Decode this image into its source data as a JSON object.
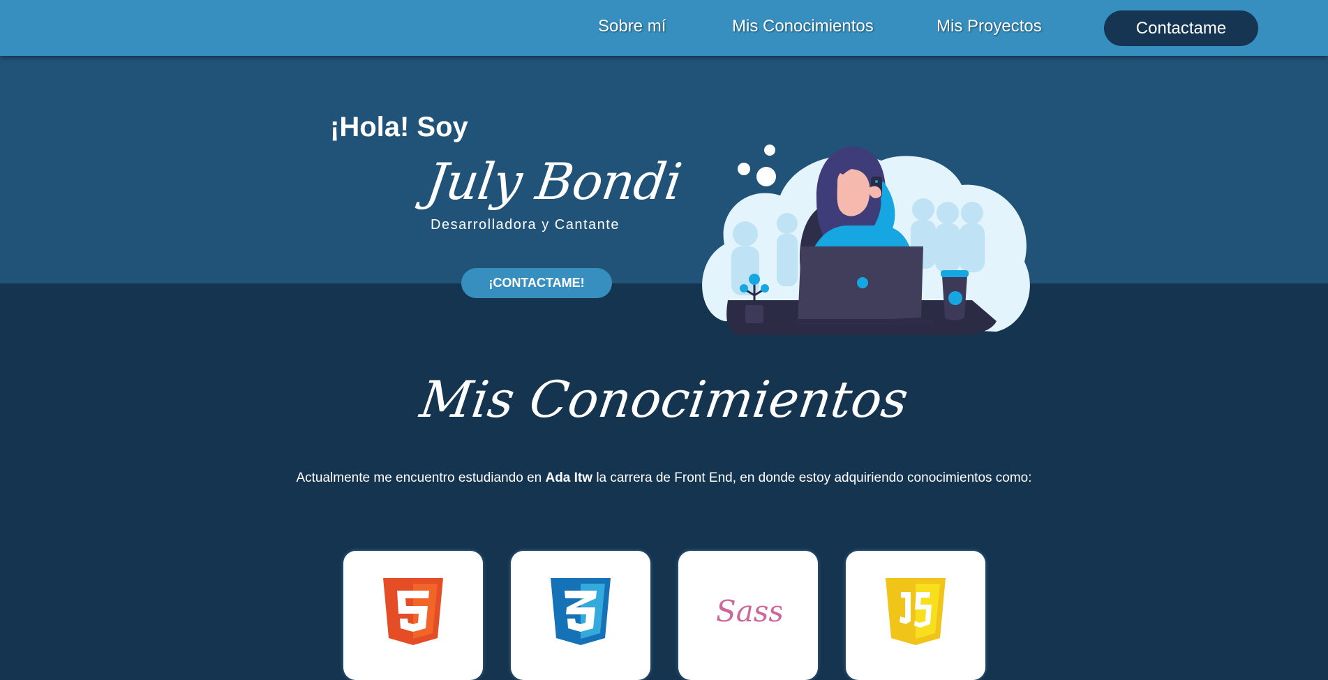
{
  "nav": {
    "links": [
      "Sobre mí",
      "Mis Conocimientos",
      "Mis Proyectos"
    ],
    "contact_label": "Contactame"
  },
  "hero": {
    "greeting": "¡Hola! Soy",
    "name": "July Bondi",
    "role": "Desarrolladora y Cantante",
    "cta_label": "¡CONTACTAME!"
  },
  "knowledge": {
    "title": "Mis Conocimientos",
    "intro_before": "Actualmente me encuentro estudiando en ",
    "intro_bold": "Ada Itw",
    "intro_after": " la carrera de Front End, en donde estoy adquiriendo conocimientos como:",
    "skills": [
      {
        "icon": "html5-icon"
      },
      {
        "icon": "css3-icon"
      },
      {
        "icon": "sass-icon",
        "logo_text": "Sass"
      },
      {
        "icon": "javascript-icon"
      }
    ]
  },
  "colors": {
    "nav_bg": "#368fbf",
    "hero_bg": "#215379",
    "page_bg": "#15344f",
    "contact_button": "#153552"
  }
}
